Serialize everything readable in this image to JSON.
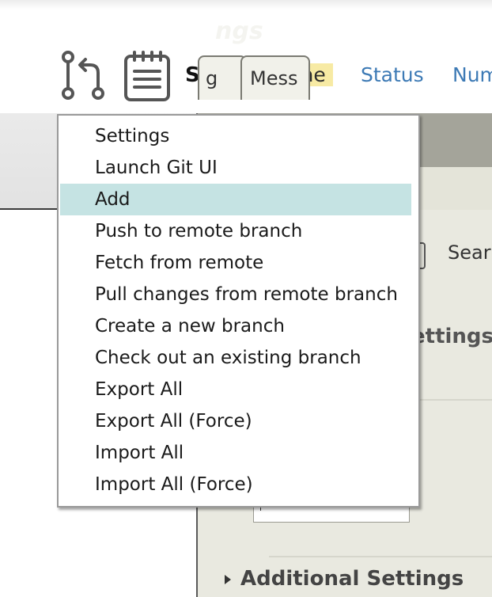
{
  "toolbar": {
    "sort_label": "Sort:",
    "sort_options": [
      "Name",
      "Status",
      "Num"
    ],
    "active_sort": "Name"
  },
  "panel": {
    "title": "ngs",
    "tabs": [
      "g",
      "Mess"
    ],
    "search_label": "Sear",
    "settings_heading": "ettings",
    "additional_settings": "Additional Settings"
  },
  "menu": {
    "items": [
      "Settings",
      "Launch Git UI",
      "Add",
      "Push to remote branch",
      "Fetch from remote",
      "Pull changes from remote branch",
      "Create a new branch",
      "Check out an existing branch",
      "Export All",
      "Export All (Force)",
      "Import All",
      "Import All (Force)"
    ],
    "highlighted": "Add"
  },
  "colors": {
    "highlight": "#c5e3e3",
    "active_sort_bg": "#f7eaa4",
    "link": "#3d7ab5",
    "panel_header": "#a4a49a"
  },
  "icons": [
    "git-pull-request-icon",
    "clipboard-icon",
    "search-icon",
    "expand-triangle-icon"
  ]
}
